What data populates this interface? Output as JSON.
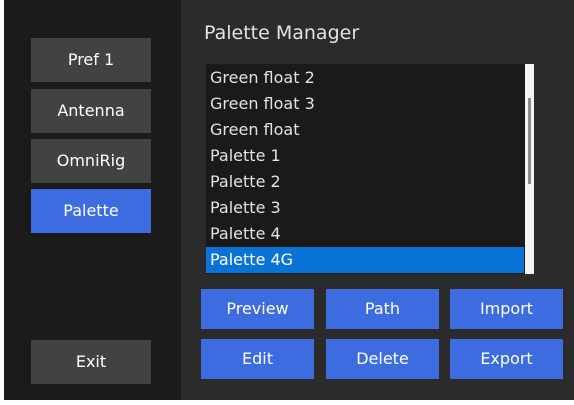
{
  "window": {
    "title": "Palette Manager"
  },
  "sidebar": {
    "items": [
      {
        "label": "Pref 1",
        "active": false
      },
      {
        "label": "Antenna",
        "active": false
      },
      {
        "label": "OmniRig",
        "active": false
      },
      {
        "label": "Palette",
        "active": true
      }
    ],
    "exit_label": "Exit"
  },
  "palette_list": {
    "items": [
      "Green float 2",
      "Green float 3",
      "Green float",
      "Palette 1",
      "Palette 2",
      "Palette 3",
      "Palette 4",
      "Palette 4G"
    ],
    "selected": "Palette 4G"
  },
  "actions": {
    "preview_label": "Preview",
    "path_label": "Path",
    "import_label": "Import",
    "edit_label": "Edit",
    "delete_label": "Delete",
    "export_label": "Export"
  },
  "colors": {
    "accent_blue": "#3d6be0",
    "selection_blue": "#0a74d6",
    "sidebar_bg": "#1b1b1b",
    "content_bg": "#2b2b2b",
    "button_gray": "#424242"
  }
}
